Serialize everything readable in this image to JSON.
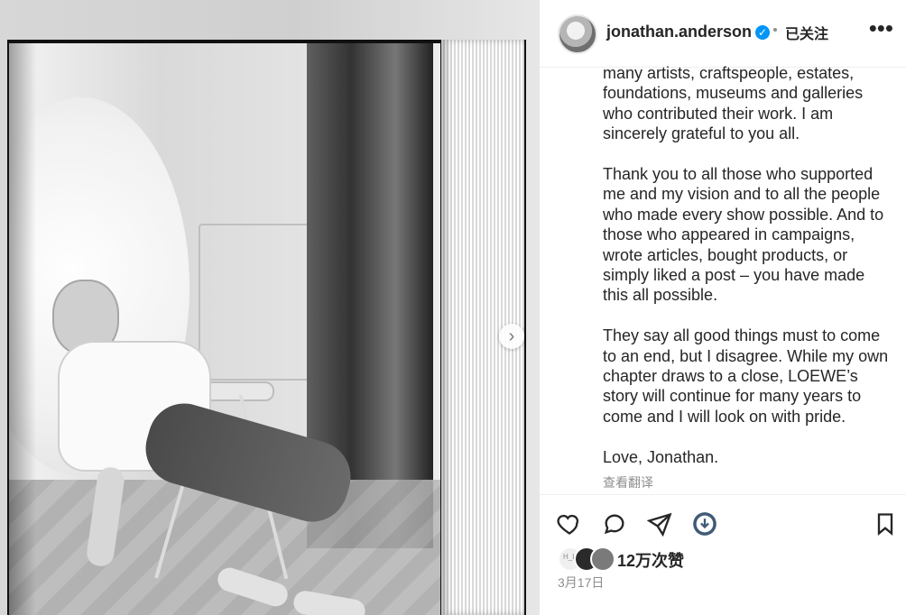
{
  "post": {
    "username": "jonathan.anderson",
    "follow_status": "已关注",
    "more_label": "•••",
    "caption_paragraphs": [
      "many artists, craftspeople, estates, foundations, museums and galleries who contributed their work. I am sincerely grateful to you all.",
      "Thank you to all those who supported me and my vision and to all the people who made every show possible. And to those who appeared in campaigns, wrote articles, bought products, or simply liked a post – you have made this all possible.",
      "They say all good things must to come to an end, but I disagree. While my own chapter draws to a close, LOEWE’s story will continue for many years to come and I will look on with pride.",
      "Love, Jonathan."
    ],
    "see_translation": "查看翻译",
    "likes": "12万次赞",
    "date": "3月17日",
    "mini_avatar_text": "H_L"
  },
  "icons": {
    "verified": "verified-badge-icon",
    "like": "heart-icon",
    "comment": "comment-icon",
    "share": "share-icon",
    "save": "bookmark-icon",
    "download": "download-icon",
    "more": "more-icon",
    "next": "chevron-right-icon"
  },
  "colors": {
    "verified_blue": "#0095f6",
    "text": "#262626",
    "secondary_text": "#8e8e8e",
    "divider": "#efefef"
  }
}
